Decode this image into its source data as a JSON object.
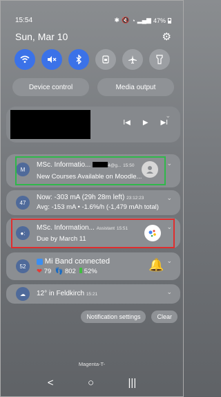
{
  "status_bar": {
    "time": "15:54",
    "icons": [
      "bluetooth-icon",
      "mute-icon",
      "wifi-icon",
      "signal-icon"
    ],
    "battery": "47%"
  },
  "header": {
    "date": "Sun, Mar 10"
  },
  "quick_toggles": [
    {
      "name": "wifi-icon",
      "state": "on"
    },
    {
      "name": "mute-icon",
      "state": "on"
    },
    {
      "name": "bluetooth-icon",
      "state": "on"
    },
    {
      "name": "screen-lock-icon",
      "state": "off"
    },
    {
      "name": "airplane-icon",
      "state": "off"
    },
    {
      "name": "flashlight-icon",
      "state": "off"
    }
  ],
  "controls": {
    "device_control": "Device control",
    "media_output": "Media output"
  },
  "notifications": [
    {
      "title": "MSc. Informatio...",
      "account": "4@g...",
      "time": "15:50",
      "body": "New Courses Available on Moodle...",
      "highlight": "green"
    },
    {
      "title": "Now: -303 mA (29h 28m left)",
      "time": "23:12:23",
      "body": "Avg: -153 mA • -1.6%/h (-1,479 mAh total)",
      "icon_label": "47"
    },
    {
      "title": "MSc. Information...",
      "app": "Assistant",
      "time": "15:51",
      "body": "Due by March 11",
      "highlight": "red"
    },
    {
      "title": "Mi Band connected",
      "icon_label": "52",
      "heart": "79",
      "steps": "802",
      "battery": "52%"
    },
    {
      "title": "12° in Feldkirch",
      "time": "15:21"
    }
  ],
  "buttons": {
    "notification_settings": "Notification settings",
    "clear": "Clear"
  },
  "carrier": "Magenta-T-",
  "colors": {
    "toggle_on": "#3b72e8",
    "highlight_green": "#2fb84a",
    "highlight_red": "#e02d2d"
  }
}
